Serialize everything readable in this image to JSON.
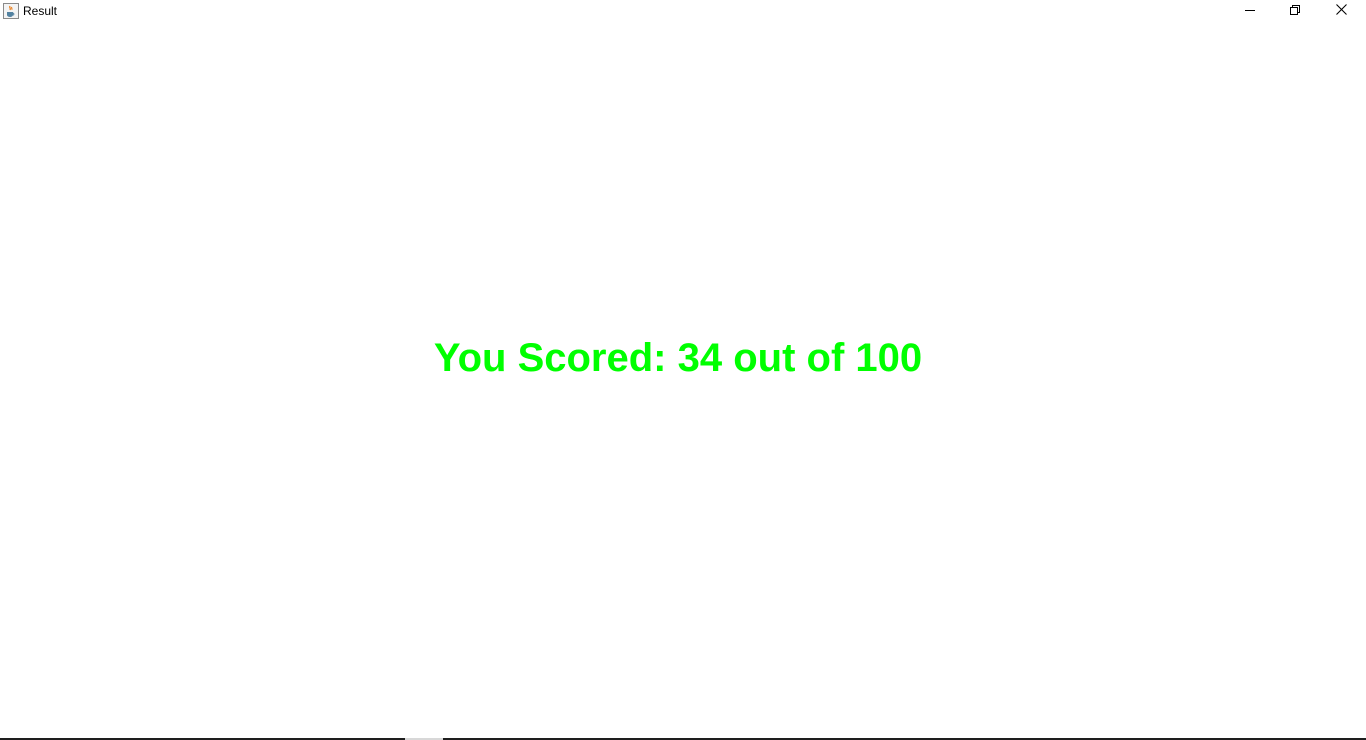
{
  "window": {
    "title": "Result",
    "app_icon": "java-cup-icon",
    "controls": {
      "minimize_icon": "minimize-icon",
      "maximize_icon": "restore-icon",
      "close_icon": "close-icon"
    }
  },
  "result": {
    "text": "You Scored: 34 out of 100",
    "color": "#00ff00"
  }
}
